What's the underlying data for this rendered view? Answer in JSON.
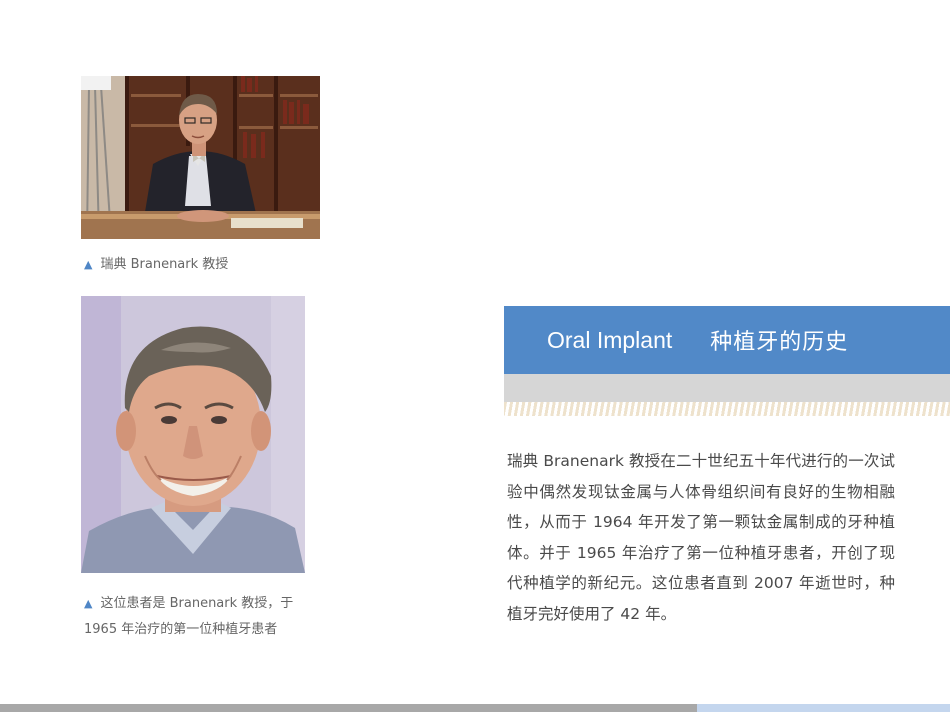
{
  "photos": [
    {
      "subject": "Professor Branemark seated at a desk in front of bookshelves"
    },
    {
      "subject": "Portrait of the first dental implant patient, smiling"
    }
  ],
  "captions": {
    "marker": "▲",
    "photo1": "瑞典  Branenark  教授",
    "photo2": "这位患者是 Branenark 教授，于 1965 年治疗的第一位种植牙患者"
  },
  "title": {
    "english": "Oral Implant",
    "chinese": "种植牙的历史"
  },
  "body_text": "瑞典  Branenark  教授在二十世纪五十年代进行的一次试验中偶然发现钛金属与人体骨组织间有良好的生物相融性，从而于 1964 年开发了第一颗钛金属制成的牙种植体。并于 1965 年治疗了第一位种植牙患者，开创了现代种植学的新纪元。这位患者直到 2007 年逝世时，种植牙完好使用了 42 年。",
  "colors": {
    "accent_blue": "#5189c8",
    "band_gray": "#d6d6d6",
    "footer_gray": "#a8a8a8",
    "footer_blue": "#c4d6ee"
  }
}
